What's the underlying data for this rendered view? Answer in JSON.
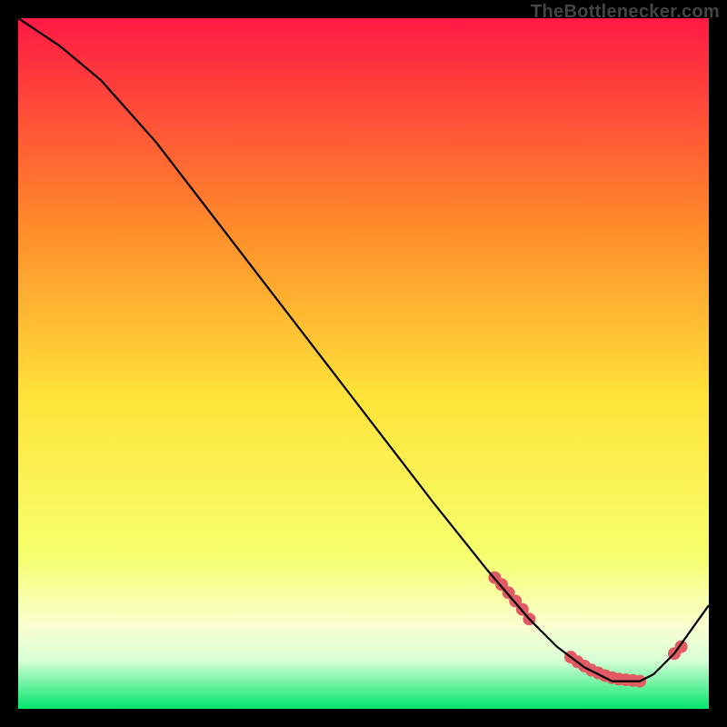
{
  "watermark": "TheBottlenecker.com",
  "colors": {
    "gradient_top": "#ff1a44",
    "gradient_mid_upper": "#ff8a2a",
    "gradient_mid": "#ffe43a",
    "gradient_mid_lower": "#f6ff6e",
    "gradient_band": "#faffd0",
    "gradient_bottom": "#00e56a",
    "marker": "#e25a63",
    "line": "#000000",
    "frame": "#000000"
  },
  "chart_data": {
    "type": "line",
    "title": "",
    "xlabel": "",
    "ylabel": "",
    "xlim": [
      0,
      100
    ],
    "ylim": [
      0,
      100
    ],
    "series": [
      {
        "name": "curve",
        "x": [
          0,
          6,
          12,
          20,
          30,
          40,
          50,
          60,
          68,
          74,
          78,
          82,
          86,
          90,
          92,
          95,
          100
        ],
        "y": [
          100,
          96,
          91,
          82,
          69,
          56,
          43,
          30,
          20,
          13,
          9,
          6,
          4,
          4,
          5,
          8,
          15
        ]
      }
    ],
    "markers": {
      "name": "highlight",
      "x": [
        69,
        70,
        71,
        72,
        73,
        74,
        80,
        81,
        82,
        83,
        84,
        85,
        86,
        87,
        88,
        89,
        90,
        95,
        96
      ],
      "y": [
        19,
        18,
        16.8,
        15.6,
        14.4,
        13,
        7.5,
        6.8,
        6.2,
        5.6,
        5.2,
        4.8,
        4.5,
        4.3,
        4.2,
        4.1,
        4.0,
        8,
        9
      ]
    }
  }
}
